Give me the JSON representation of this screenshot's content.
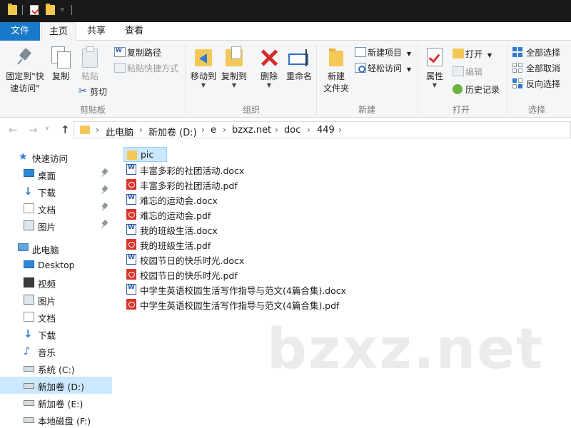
{
  "ribbon_tabs": {
    "file": "文件",
    "home": "主页",
    "share": "共享",
    "view": "查看"
  },
  "clipboard": {
    "pin_quick_access_line1": "固定到\"快",
    "pin_quick_access_line2": "速访问\"",
    "copy": "复制",
    "paste": "粘贴",
    "copy_path": "复制路径",
    "paste_shortcut": "粘贴快捷方式",
    "cut": "剪切",
    "group_label": "剪贴板"
  },
  "organize": {
    "move_to": "移动到",
    "copy_to": "复制到",
    "delete": "删除",
    "rename": "重命名",
    "group_label": "组织"
  },
  "new_group": {
    "new_folder_line1": "新建",
    "new_folder_line2": "文件夹",
    "new_item": "新建项目",
    "easy_access": "轻松访问",
    "group_label": "新建"
  },
  "open_group": {
    "properties": "属性",
    "open": "打开",
    "edit": "编辑",
    "history": "历史记录",
    "group_label": "打开"
  },
  "select_group": {
    "select_all": "全部选择",
    "select_none": "全部取消",
    "invert_selection": "反向选择",
    "group_label": "选择"
  },
  "breadcrumb": [
    "此电脑",
    "新加卷 (D:)",
    "e",
    "bzxz.net",
    "doc",
    "449"
  ],
  "sidebar": {
    "quick_access": "快速访问",
    "quick_items": [
      "桌面",
      "下载",
      "文档",
      "图片"
    ],
    "this_pc": "此电脑",
    "pc_items": [
      "Desktop",
      "视频",
      "图片",
      "文档",
      "下载",
      "音乐",
      "系统 (C:)",
      "新加卷 (D:)",
      "新加卷 (E:)",
      "本地磁盘 (F:)"
    ]
  },
  "files": [
    "pic",
    "丰富多彩的社团活动.docx",
    "丰富多彩的社团活动.pdf",
    "难忘的运动会.docx",
    "难忘的运动会.pdf",
    "我的班级生活.docx",
    "我的班级生活.pdf",
    "校园节日的快乐时光.docx",
    "校园节日的快乐时光.pdf",
    "中学生英语校园生活写作指导与范文(4篇合集).docx",
    "中学生英语校园生活写作指导与范文(4篇合集).pdf"
  ],
  "watermark": "bzxz.net"
}
